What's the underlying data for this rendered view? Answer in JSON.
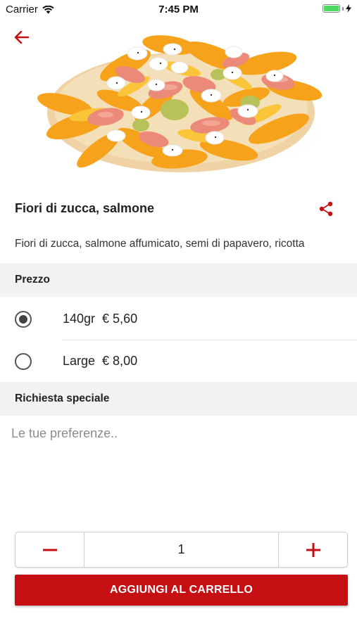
{
  "status_bar": {
    "carrier": "Carrier",
    "time": "7:45 PM",
    "battery_level": 1.0,
    "battery_color": "#4cd964"
  },
  "header": {
    "back_icon": "arrow-left-icon",
    "accent_color": "#c60f13"
  },
  "product": {
    "image": "pizza-zucchini-flowers-salmon-photo",
    "title": "Fiori di zucca, salmone",
    "share_icon": "share-icon",
    "description": "Fiori di zucca, salmone affumicato, semi di papavero, ricotta"
  },
  "price_section": {
    "title": "Prezzo",
    "options": [
      {
        "label": "140gr  € 5,60",
        "selected": true
      },
      {
        "label": "Large  € 8,00",
        "selected": false
      }
    ]
  },
  "special_request": {
    "title": "Richiesta speciale",
    "placeholder": "Le tue preferenze..",
    "value": ""
  },
  "quantity": {
    "minus_icon": "minus-icon",
    "plus_icon": "plus-icon",
    "value": "1"
  },
  "add_to_cart": {
    "label": "AGGIUNGI AL CARRELLO",
    "color": "#c60f13"
  }
}
